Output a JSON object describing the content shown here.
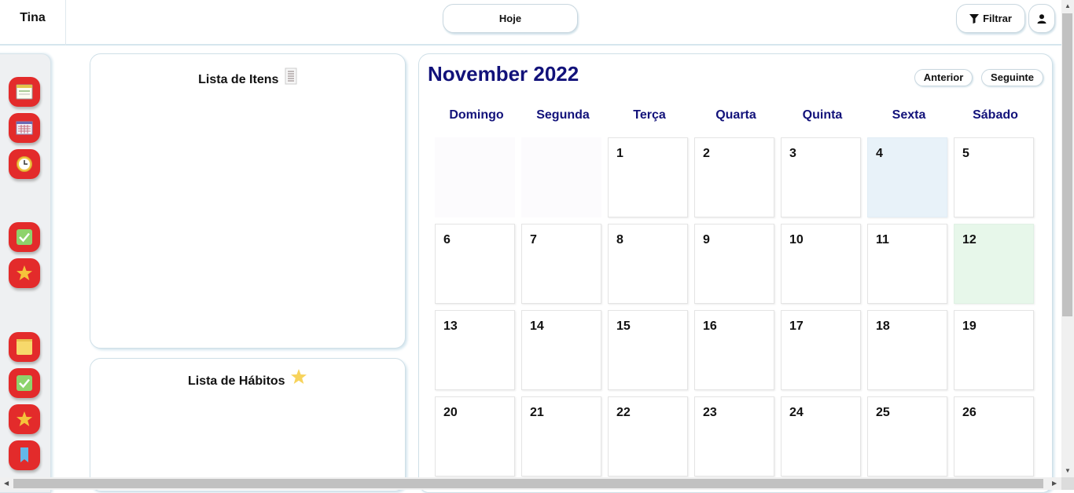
{
  "header": {
    "brand": "Tina",
    "today_label": "Hoje",
    "filter_label": "Filtrar",
    "filter_icon": "filter-icon",
    "user_icon": "user-icon"
  },
  "sidebar": {
    "items": [
      {
        "name": "calendar-week",
        "icon": "calendar-icon"
      },
      {
        "name": "calendar-month",
        "icon": "calendar-grid-icon"
      },
      {
        "name": "clock",
        "icon": "clock-icon"
      },
      {
        "name": "tasks",
        "icon": "checkmark-icon"
      },
      {
        "name": "favorites",
        "icon": "star-icon"
      },
      {
        "name": "notes",
        "icon": "note-icon"
      },
      {
        "name": "habits-check",
        "icon": "checkmark-icon"
      },
      {
        "name": "habits-star",
        "icon": "star-icon"
      },
      {
        "name": "bookmark",
        "icon": "bookmark-icon"
      }
    ]
  },
  "items_panel": {
    "title": "Lista de Itens",
    "icon": "list-icon"
  },
  "habits_panel": {
    "title": "Lista de Hábitos",
    "icon": "star-icon"
  },
  "calendar": {
    "month_title": "November 2022",
    "prev_label": "Anterior",
    "next_label": "Seguinte",
    "weekdays": [
      "Domingo",
      "Segunda",
      "Terça",
      "Quarta",
      "Quinta",
      "Sexta",
      "Sábado"
    ],
    "weeks": [
      [
        "",
        "",
        "1",
        "2",
        "3",
        "4",
        "5"
      ],
      [
        "6",
        "7",
        "8",
        "9",
        "10",
        "11",
        "12"
      ],
      [
        "13",
        "14",
        "15",
        "16",
        "17",
        "18",
        "19"
      ],
      [
        "20",
        "21",
        "22",
        "23",
        "24",
        "25",
        "26"
      ]
    ],
    "today": "4",
    "marked_days": [
      "12"
    ]
  },
  "colors": {
    "accent": "#e32b2b",
    "title_blue": "#12127a",
    "today_bg": "#e8f2f9",
    "marked_bg": "#e7f7ea"
  }
}
